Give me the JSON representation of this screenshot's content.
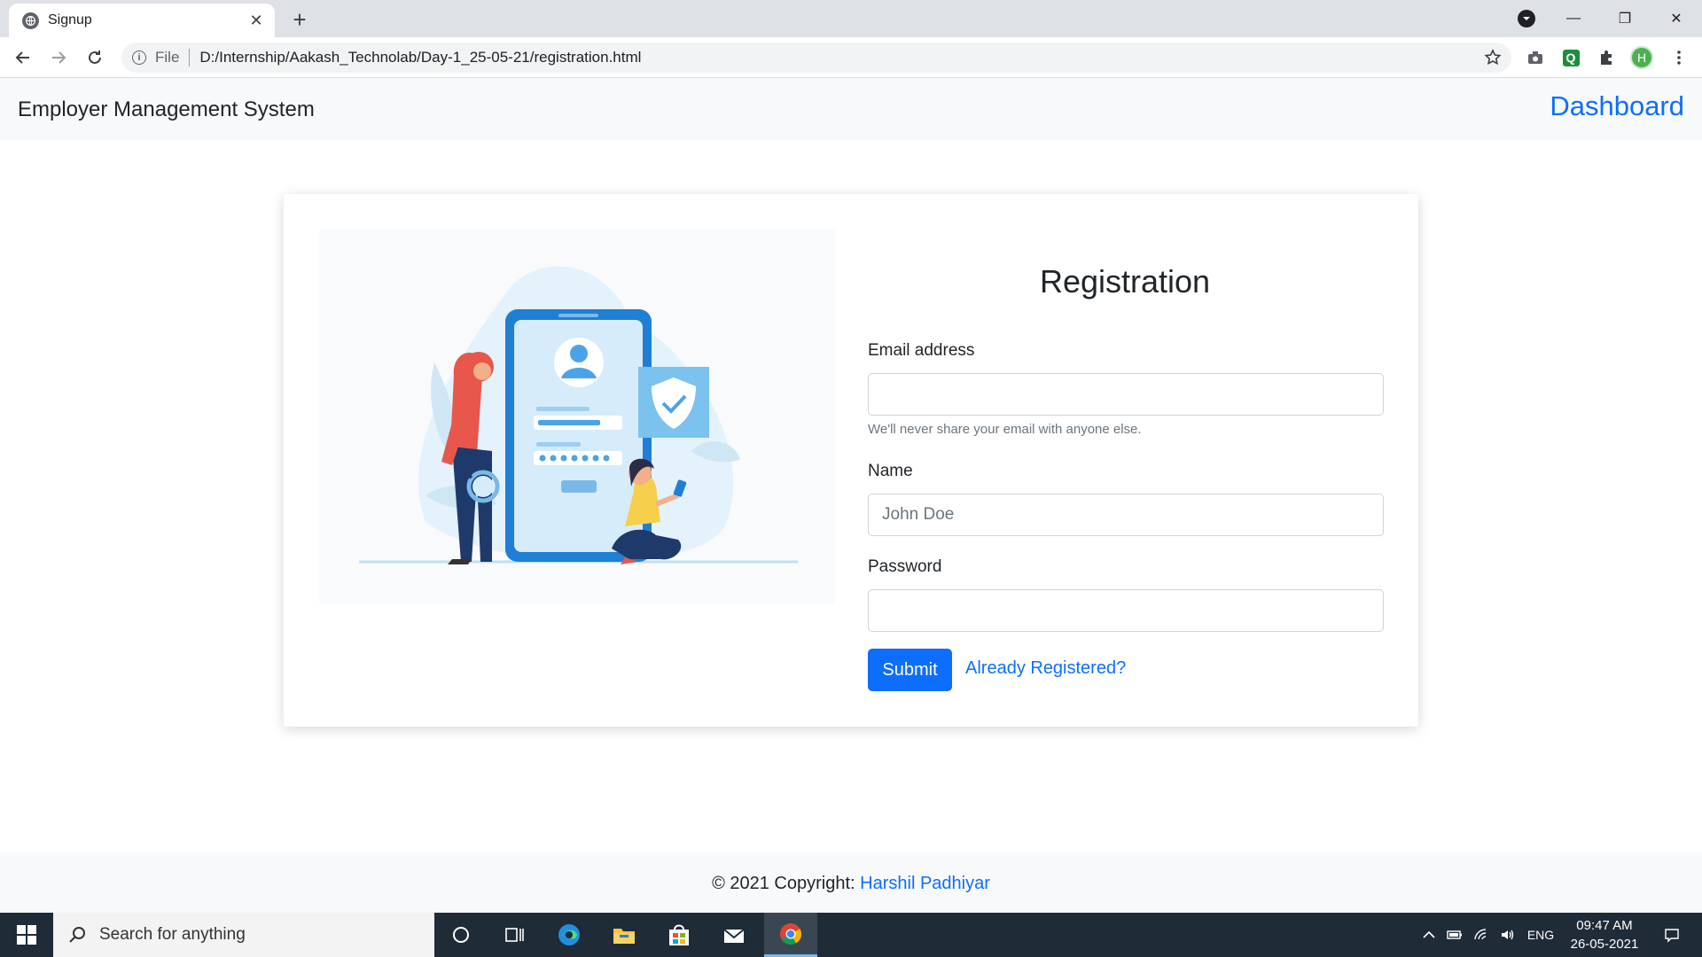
{
  "browser": {
    "tab_title": "Signup",
    "omnibox_scheme": "File",
    "url": "D:/Internship/Aakash_Technolab/Day-1_25-05-21/registration.html",
    "profile_initial": "H",
    "extension_q_label": "Q"
  },
  "navbar": {
    "brand": "Employer Management System",
    "dashboard_link": "Dashboard"
  },
  "form": {
    "title": "Registration",
    "email_label": "Email address",
    "email_value": "",
    "email_help": "We'll never share your email with anyone else.",
    "name_label": "Name",
    "name_placeholder": "John Doe",
    "password_label": "Password",
    "password_value": "",
    "submit_label": "Submit",
    "already_link": "Already Registered?"
  },
  "footer": {
    "copyright": "© 2021 Copyright:",
    "author": "Harshil Padhiyar"
  },
  "taskbar": {
    "search_placeholder": "Search for anything",
    "language": "ENG",
    "time": "09:47 AM",
    "date": "26-05-2021"
  },
  "colors": {
    "primary": "#0d6efd",
    "navbar_bg": "#f8f9fa",
    "taskbar_bg": "#1f2b37"
  }
}
